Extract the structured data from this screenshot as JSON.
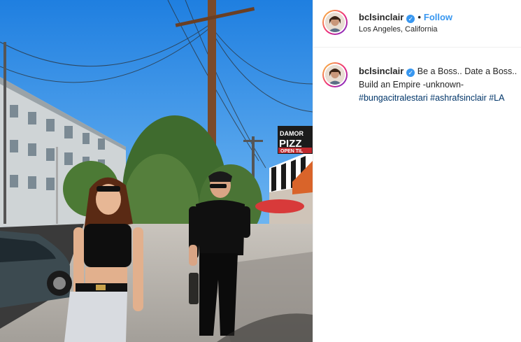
{
  "post": {
    "username": "bclsinclair",
    "verified_glyph": "✓",
    "separator": "•",
    "follow_label": "Follow",
    "location": "Los Angeles, California"
  },
  "caption": {
    "username": "bclsinclair",
    "verified_glyph": "✓",
    "line1": "Be a Boss.. Date a Boss..",
    "line2": "Build an Empire -unknown-",
    "hashtags": "#bungacitralestari #ashrafsinclair #LA"
  },
  "photo": {
    "signs": {
      "damor": "DAMOR",
      "pizza": "PIZZ",
      "open": "OPEN TIL"
    }
  },
  "colors": {
    "accent": "#3897f0",
    "hashtag": "#003569",
    "sky": "#2f8ae0"
  }
}
